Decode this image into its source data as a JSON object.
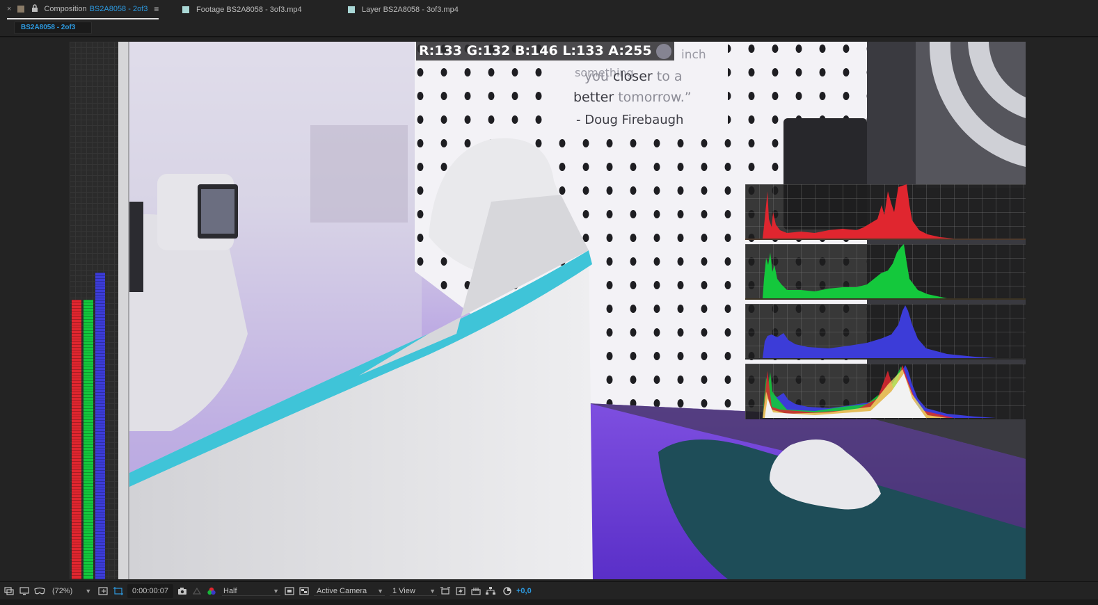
{
  "tabs": {
    "close_glyph": "×",
    "composition": {
      "prefix": "Composition",
      "name": "BS2A8058 - 2of3",
      "swatch": "#8a7b67"
    },
    "footage": {
      "label": "Footage BS2A8058 - 3of3.mp4",
      "swatch": "#a9d7d5"
    },
    "layer": {
      "label": "Layer BS2A8058 - 3of3.mp4",
      "swatch": "#a9d7d5"
    }
  },
  "comp_chip": "BS2A8058 - 2of3",
  "viewer": {
    "pixel_readout": "R:133 G:132 B:146 L:133 A:255",
    "sampled_color": "#858492",
    "rgb_meter": {
      "r": 0.52,
      "g": 0.52,
      "b": 0.57
    },
    "scene_text": {
      "top_word": "inch",
      "line0": "something",
      "line1a": "you ",
      "line1b": "closer",
      "line1c": " to a",
      "line2a": "better",
      "line2b": " tomorrow.”",
      "attribution": "- Doug Firebaugh"
    }
  },
  "colors": {
    "accent": "#2d9ae0",
    "red": "#e0262f",
    "green": "#14c83c",
    "blue": "#3c3cd8"
  },
  "toolbar": {
    "zoom": "(72%)",
    "timecode": "0:00:00:07",
    "resolution": "Half",
    "camera": "Active Camera",
    "views": "1 View",
    "exposure": "+0,0"
  }
}
